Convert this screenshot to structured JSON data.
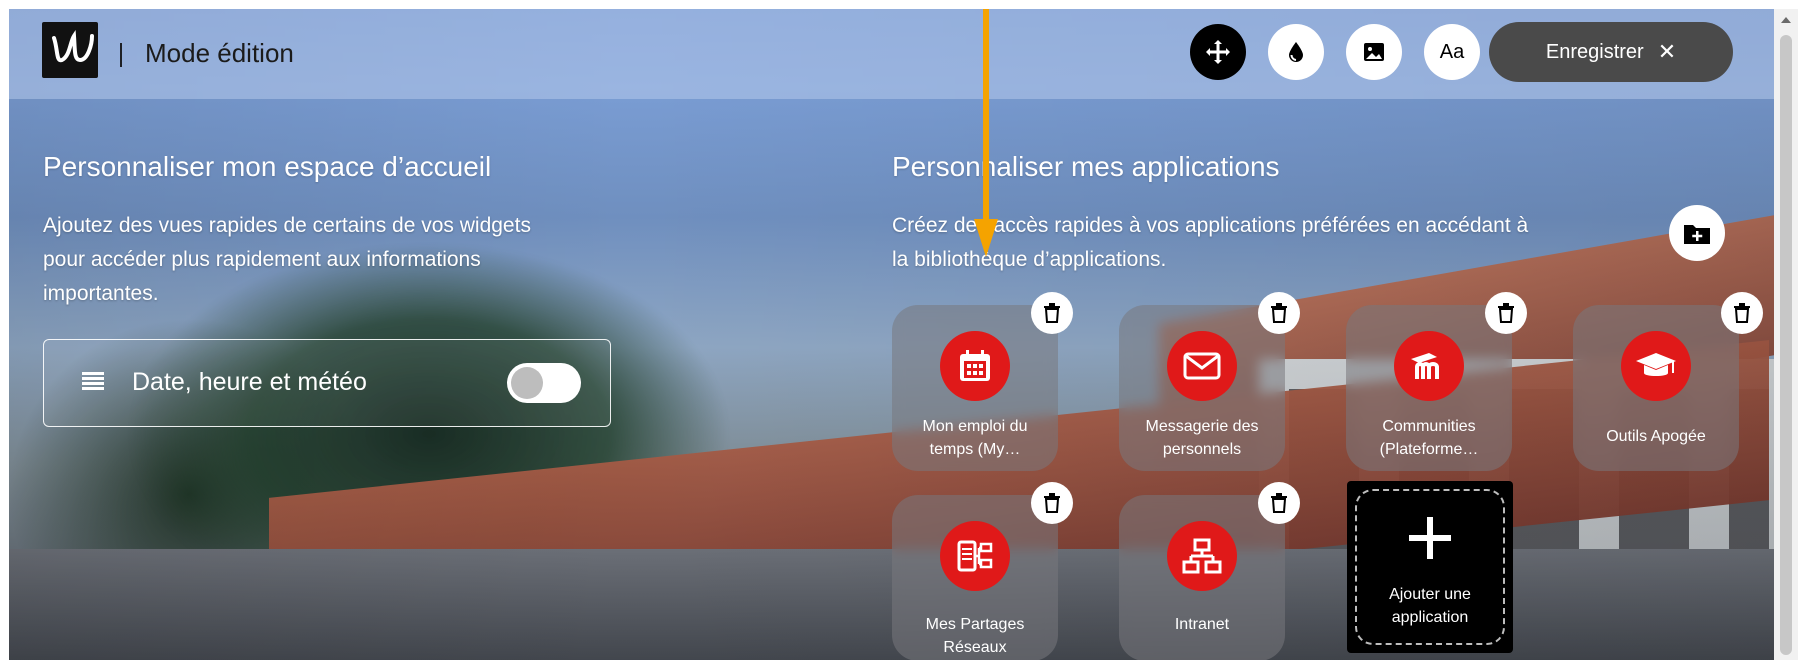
{
  "topbar": {
    "title": "Mode édition",
    "tools": [
      {
        "icon": "move-icon"
      },
      {
        "icon": "drop-icon"
      },
      {
        "icon": "image-icon"
      },
      {
        "icon": "font-icon",
        "label": "Aa"
      }
    ],
    "save_label": "Enregistrer",
    "close_glyph": "✕"
  },
  "left": {
    "heading": "Personnaliser mon espace d’accueil",
    "text_lines": [
      "Ajoutez des vues rapides de certains de vos widgets",
      "pour accéder plus rapidement aux informations",
      "importantes."
    ],
    "widget_label": "Date, heure et météo",
    "widget_enabled": false
  },
  "right": {
    "heading": "Personnaliser mes applications",
    "text_lines": [
      "Créez des accès rapides à vos applications préférées en accédant à",
      "la bibliothèque d’applications."
    ],
    "apps": [
      {
        "name_lines": [
          "Mon emploi du",
          "temps (My…"
        ],
        "icon": "calendar-icon"
      },
      {
        "name_lines": [
          "Messagerie des",
          "personnels"
        ],
        "icon": "mail-icon"
      },
      {
        "name_lines": [
          "Communities",
          "(Plateforme…"
        ],
        "icon": "moodle-icon"
      },
      {
        "name_lines": [
          "Outils Apogée"
        ],
        "icon": "graduation-cap-icon"
      },
      {
        "name_lines": [
          "Mes Partages",
          "Réseaux"
        ],
        "icon": "network-share-icon"
      },
      {
        "name_lines": [
          "Intranet"
        ],
        "icon": "sitemap-icon"
      }
    ],
    "add_app": {
      "name_lines": [
        "Ajouter une",
        "application"
      ]
    }
  },
  "colors": {
    "accent_red": "#e01919",
    "save_bg": "#4a4a4a",
    "arrow": "#f5a300"
  }
}
